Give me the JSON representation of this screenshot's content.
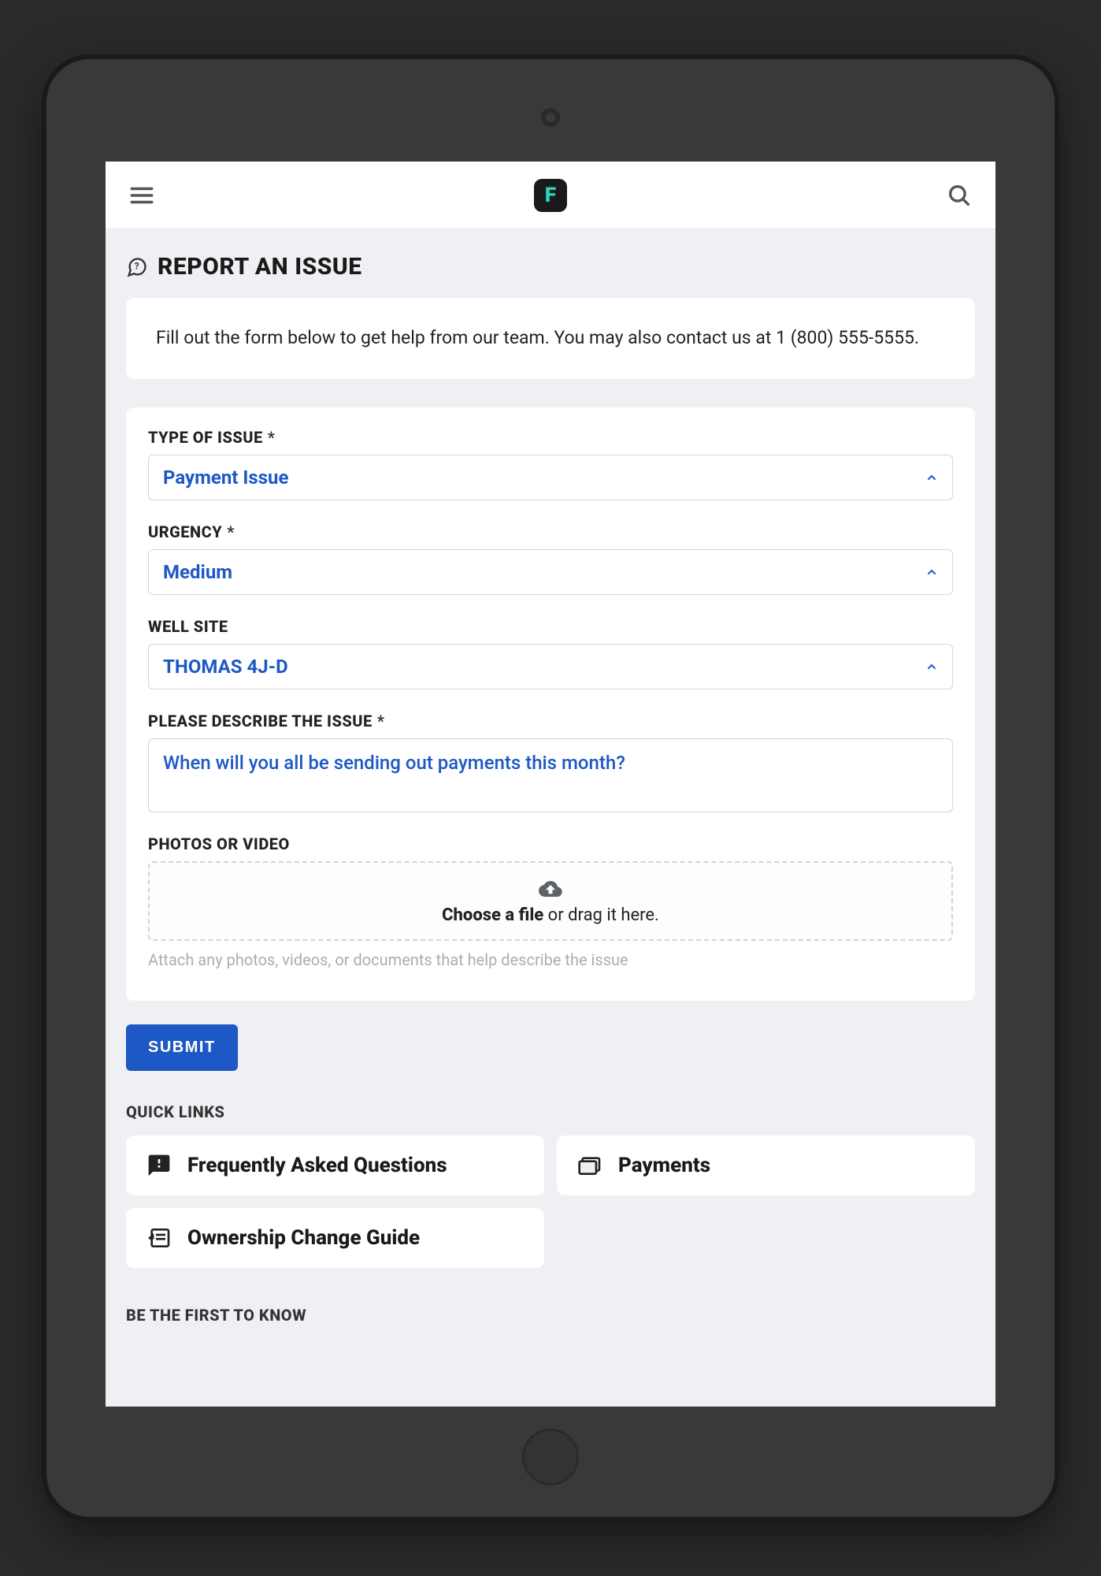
{
  "header": {
    "logo_letter": "F"
  },
  "page": {
    "title": "REPORT AN ISSUE",
    "info": "Fill out the form below to get help from our team. You may also contact us at 1 (800) 555-5555."
  },
  "form": {
    "type_of_issue": {
      "label": "TYPE OF ISSUE",
      "required": "*",
      "value": "Payment Issue"
    },
    "urgency": {
      "label": "URGENCY",
      "required": "*",
      "value": "Medium"
    },
    "well_site": {
      "label": "WELL SITE",
      "value": "THOMAS 4J-D"
    },
    "description": {
      "label": "PLEASE DESCRIBE THE ISSUE",
      "required": "*",
      "value": "When will you all be sending out payments this month?"
    },
    "upload": {
      "label": "PHOTOS OR VIDEO",
      "choose_text": "Choose a file",
      "drag_text": " or drag it here.",
      "help": "Attach any photos, videos, or documents that help describe the issue"
    },
    "submit_label": "SUBMIT"
  },
  "quick_links": {
    "heading": "QUICK LINKS",
    "items": [
      {
        "label": "Frequently Asked Questions"
      },
      {
        "label": "Payments"
      },
      {
        "label": "Ownership Change Guide"
      }
    ]
  },
  "subscribe": {
    "heading": "BE THE FIRST TO KNOW"
  }
}
